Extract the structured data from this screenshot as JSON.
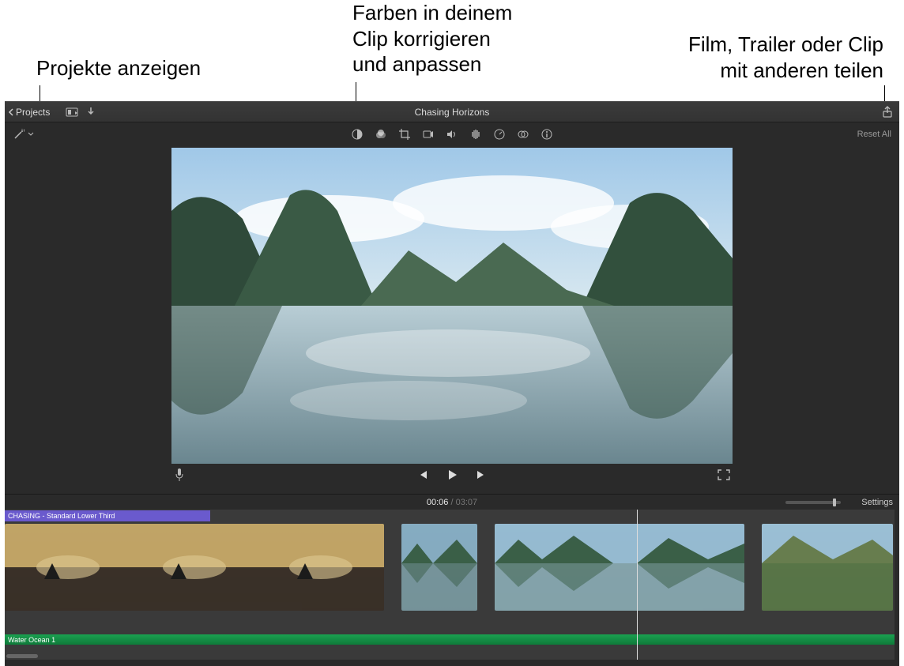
{
  "callouts": {
    "projects": "Projekte anzeigen",
    "color": "Farben in deinem\nClip korrigieren\nund anpassen",
    "share": "Film, Trailer oder Clip\nmit anderen teilen"
  },
  "titlebar": {
    "projects_label": "Projects",
    "title": "Chasing Horizons"
  },
  "adjust": {
    "reset_label": "Reset All"
  },
  "time": {
    "current": "00:06",
    "separator": " / ",
    "total": "03:07",
    "settings_label": "Settings"
  },
  "timeline": {
    "title_clip": "CHASING - Standard Lower Third",
    "audio_clip": "Water Ocean 1"
  }
}
